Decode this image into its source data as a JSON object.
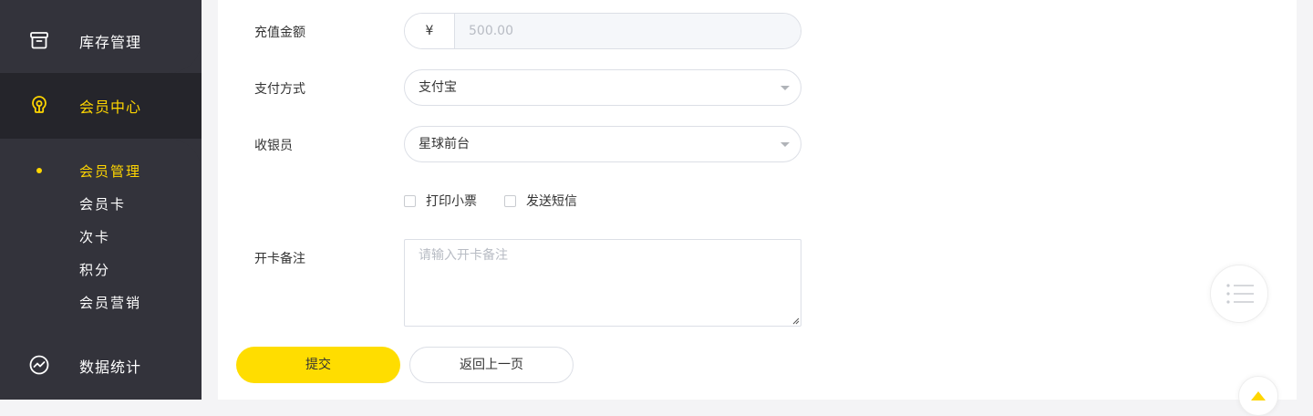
{
  "sidebar": {
    "nav": [
      {
        "label": "库存管理",
        "icon": "archive-box-icon"
      },
      {
        "label": "会员中心",
        "icon": "lightbulb-icon"
      },
      {
        "label": "数据统计",
        "icon": "chart-trend-icon"
      }
    ],
    "sub_items": [
      {
        "label": "会员管理"
      },
      {
        "label": "会员卡"
      },
      {
        "label": "次卡"
      },
      {
        "label": "积分"
      },
      {
        "label": "会员营销"
      }
    ]
  },
  "form": {
    "amount": {
      "label": "充值金额",
      "currency_symbol": "¥",
      "value": "500.00"
    },
    "payment": {
      "label": "支付方式",
      "value": "支付宝"
    },
    "cashier": {
      "label": "收银员",
      "value": "星球前台"
    },
    "options": {
      "print_receipt": "打印小票",
      "send_sms": "发送短信"
    },
    "remark": {
      "label": "开卡备注",
      "placeholder": "请输入开卡备注"
    },
    "buttons": {
      "submit": "提交",
      "back": "返回上一页"
    }
  },
  "colors": {
    "accent": "#ffd600",
    "submit_bg": "#ffdd00",
    "sidebar_bg": "#33333b",
    "sidebar_active_bg": "#25252b"
  }
}
